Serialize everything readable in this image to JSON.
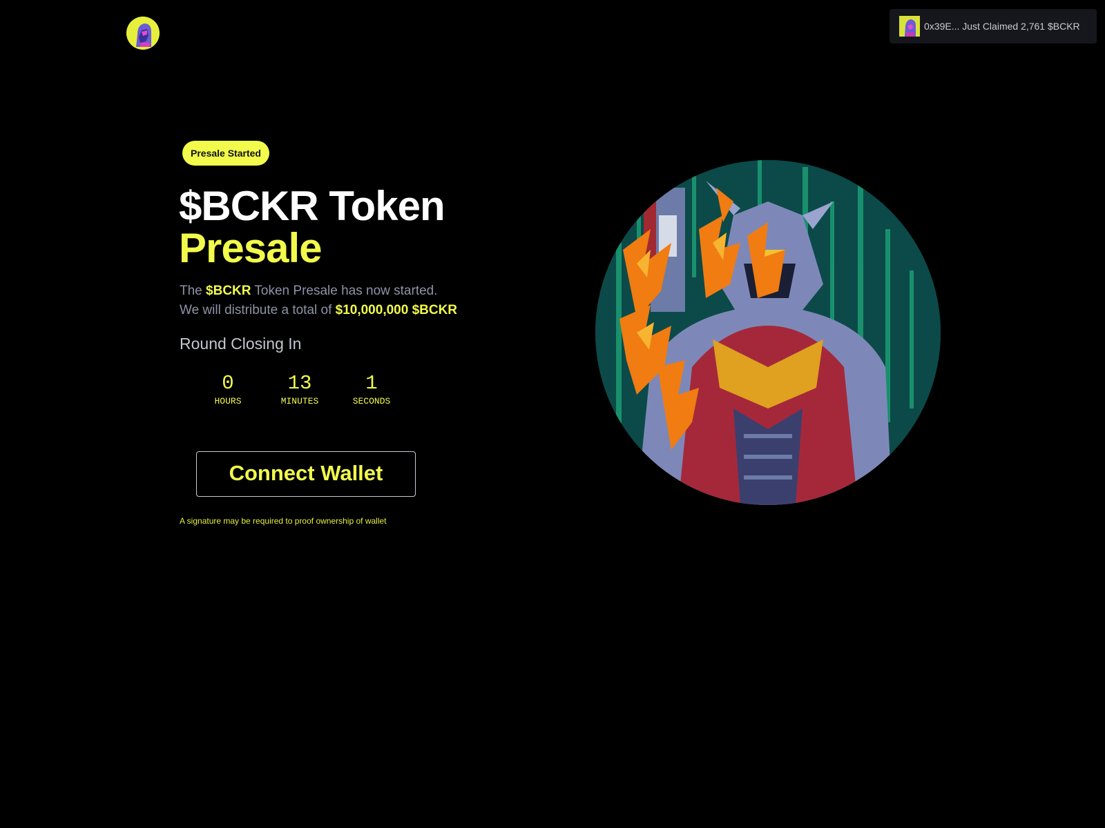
{
  "header": {
    "logo_icon": "robot-avatar-icon",
    "toast": {
      "thumb_icon": "robot-avatar-icon",
      "text": "0x39E... Just Claimed 2,761 $BCKR"
    }
  },
  "hero": {
    "badge": "Presale Started",
    "title_line1": "$BCKR Token",
    "title_line2": "Presale",
    "desc_line1_pre": "The ",
    "desc_line1_token": "$BCKR",
    "desc_line1_post": " Token Presale has now started.",
    "desc_line2_pre": "We will distribute a total of ",
    "desc_line2_amount": "$10,000,000 $BCKR",
    "round_label": "Round Closing In",
    "countdown": [
      {
        "value": "0",
        "label": "HOURS"
      },
      {
        "value": "13",
        "label": "MINUTES"
      },
      {
        "value": "1",
        "label": "SECONDS"
      }
    ],
    "connect_label": "Connect Wallet",
    "signature_note": "A signature may be required to proof ownership of wallet",
    "image_icon": "armored-robot-flames-icon"
  },
  "colors": {
    "accent": "#f2fb4b",
    "background": "#000000",
    "muted_text": "#8e93a6",
    "toast_bg": "#15171c",
    "hero_bg": "#0b4a48"
  }
}
